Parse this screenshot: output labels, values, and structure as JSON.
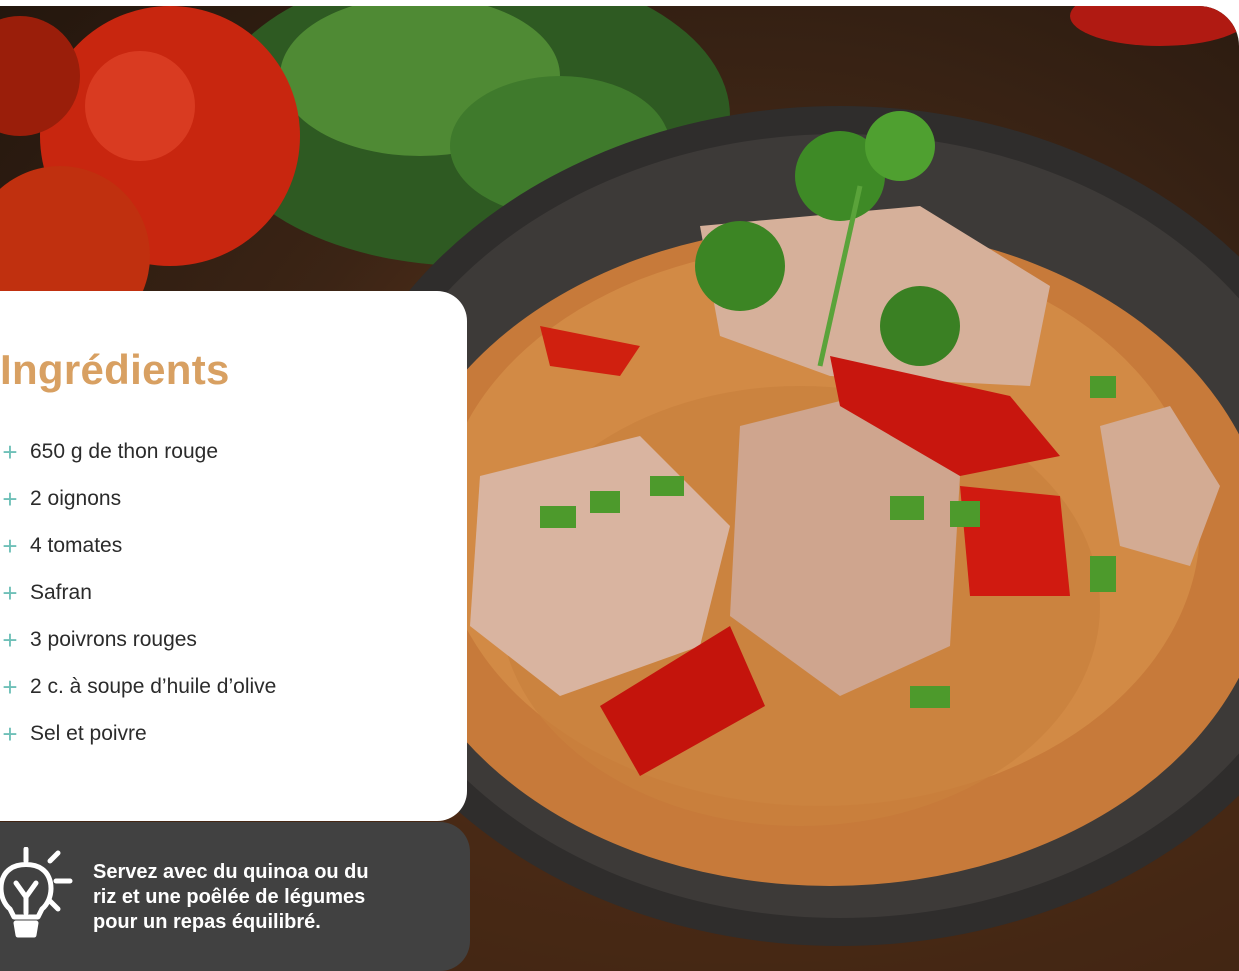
{
  "ingredients": {
    "title": "Ingrédients",
    "plus_icon": "plus-icon",
    "items": [
      "650 g de thon rouge",
      "2 oignons",
      "4 tomates",
      "Safran",
      "3 poivrons rouges",
      "2 c. à soupe d’huile d’olive",
      "Sel et poivre"
    ]
  },
  "tip": {
    "icon": "lightbulb-icon",
    "text_lines": [
      "Servez avec du quinoa ou du",
      "riz et une poêlée de légumes",
      "pour un repas équilibré."
    ]
  },
  "photo": {
    "subject": "photo-rice-tuna-bowl"
  },
  "colors": {
    "title": "#d8a062",
    "accent": "#6fc0b8",
    "tip_background": "#414141"
  }
}
